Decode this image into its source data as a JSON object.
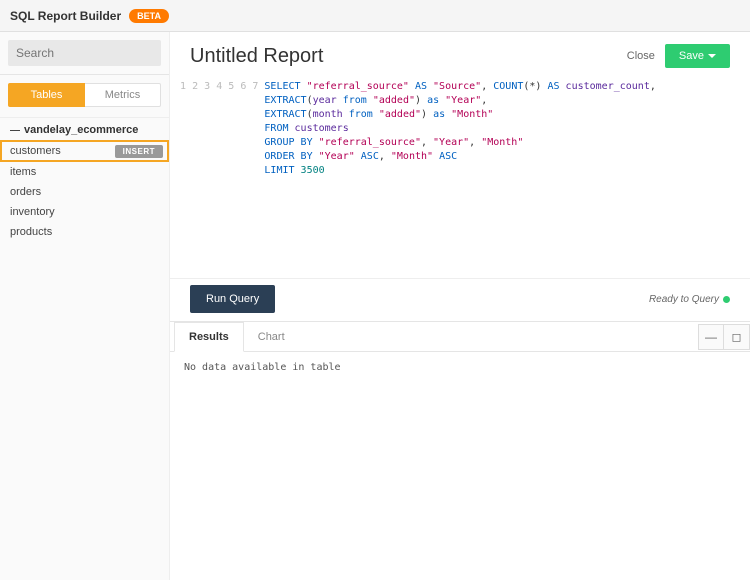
{
  "app": {
    "title": "SQL Report Builder",
    "badge": "BETA"
  },
  "search": {
    "placeholder": "Search"
  },
  "sidebar_tabs": {
    "tables": "Tables",
    "metrics": "Metrics"
  },
  "database": {
    "name": "vandelay_ecommerce"
  },
  "tables": {
    "customers": "customers",
    "items": "items",
    "orders": "orders",
    "inventory": "inventory",
    "products": "products"
  },
  "insert_label": "INSERT",
  "report": {
    "title": "Untitled Report"
  },
  "actions": {
    "close": "Close",
    "save": "Save",
    "run": "Run Query"
  },
  "status": {
    "text": "Ready to Query"
  },
  "result_tabs": {
    "results": "Results",
    "chart": "Chart"
  },
  "results": {
    "empty": "No data available in table"
  },
  "sql": {
    "line1": {
      "select": "SELECT",
      "col1": "\"referral_source\"",
      "as": "AS",
      "alias1": "\"Source\"",
      "count": "COUNT",
      "star": "(*)",
      "alias2": "customer_count",
      "comma": ","
    },
    "line2": {
      "func": "EXTRACT",
      "open": "(",
      "part": "year",
      "from": "from",
      "col": "\"added\"",
      "close": ")",
      "as": "as",
      "alias": "\"Year\"",
      "comma": ","
    },
    "line3": {
      "func": "EXTRACT",
      "open": "(",
      "part": "month",
      "from": "from",
      "col": "\"added\"",
      "close": ")",
      "as": "as",
      "alias": "\"Month\""
    },
    "line4": {
      "from": "FROM",
      "table": "customers"
    },
    "line5": {
      "group": "GROUP",
      "by": "BY",
      "c1": "\"referral_source\"",
      "c2": "\"Year\"",
      "c3": "\"Month\""
    },
    "line6": {
      "order": "ORDER",
      "by": "BY",
      "c1": "\"Year\"",
      "d1": "ASC",
      "c2": "\"Month\"",
      "d2": "ASC"
    },
    "line7": {
      "limit": "LIMIT",
      "n": "3500"
    },
    "lines": {
      "l1": "1",
      "l2": "2",
      "l3": "3",
      "l4": "4",
      "l5": "5",
      "l6": "6",
      "l7": "7"
    }
  }
}
